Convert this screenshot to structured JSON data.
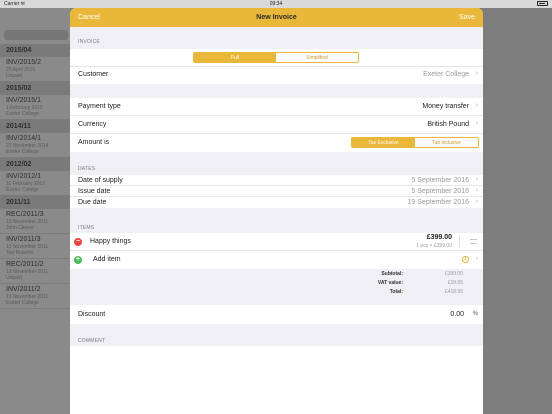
{
  "statusbar": {
    "carrier": "Carrier ✉",
    "time": "09:34"
  },
  "background_list": {
    "groups": [
      {
        "header": "2015/04",
        "items": [
          {
            "title": "INV/2015/2",
            "sub1": "20 April 2015",
            "sub2": "Unpaid"
          }
        ]
      },
      {
        "header": "2015/02",
        "items": [
          {
            "title": "INV/2015/1",
            "sub1": "1 February 2015",
            "sub2": "Exeter College"
          }
        ]
      },
      {
        "header": "2014/11",
        "items": [
          {
            "title": "INV/2014/1",
            "sub1": "22 November 2014",
            "sub2": "Exeter College"
          }
        ]
      },
      {
        "header": "2012/02",
        "items": [
          {
            "title": "INV/2012/1",
            "sub1": "11 February 2012",
            "sub2": "Exeter College"
          }
        ]
      },
      {
        "header": "2011/11",
        "items": [
          {
            "title": "REC/2011/3",
            "sub1": "19 November 2011",
            "sub2": "John Cleese"
          },
          {
            "title": "INV/2011/3",
            "sub1": "12 November 2011",
            "sub2": "Ted Roberts"
          },
          {
            "title": "REC/2011/2",
            "sub1": "12 November 2011",
            "sub2": "Unpaid"
          },
          {
            "title": "INV/2011/2",
            "sub1": "13 November 2011",
            "sub2": "Exeter College"
          }
        ]
      }
    ]
  },
  "nav": {
    "cancel": "Cancel",
    "title": "New Invoice",
    "save": "Save"
  },
  "invoice_section": {
    "header": "INVOICE",
    "segment": {
      "options": [
        "Full",
        "Simplified"
      ],
      "selected": "Full"
    },
    "customer_label": "Customer",
    "customer_value": "Exeter College"
  },
  "payment_section": {
    "payment_type_label": "Payment type",
    "payment_type_value": "Money transfer",
    "currency_label": "Currency",
    "currency_value": "British Pound",
    "amount_label": "Amount is",
    "amount_segment": {
      "options": [
        "Tax Exclusive",
        "Tax Inclusive"
      ],
      "selected": "Tax Exclusive"
    }
  },
  "dates_section": {
    "header": "DATES",
    "rows": [
      {
        "label": "Date of supply",
        "value": "5 September 2016"
      },
      {
        "label": "Issue date",
        "value": "5 September 2016"
      },
      {
        "label": "Due date",
        "value": "19 September 2016"
      }
    ]
  },
  "items_section": {
    "header": "ITEMS",
    "item": {
      "name": "Happy things",
      "amount": "£399.00",
      "detail": "1 pcs × £399.00"
    },
    "add_label": "Add item",
    "add_badge": "1"
  },
  "totals": [
    {
      "label": "Subtotal:",
      "value": "£399.00"
    },
    {
      "label": "VAT value:",
      "value": "£19.95"
    },
    {
      "label": "Total:",
      "value": "£418.95"
    }
  ],
  "discount": {
    "label": "Discount",
    "value": "0.00",
    "unit": "%"
  },
  "comment": {
    "header": "COMMENT"
  },
  "colors": {
    "accent": "#e9b83a",
    "delete": "#e9473d",
    "add": "#4cbb5a"
  }
}
